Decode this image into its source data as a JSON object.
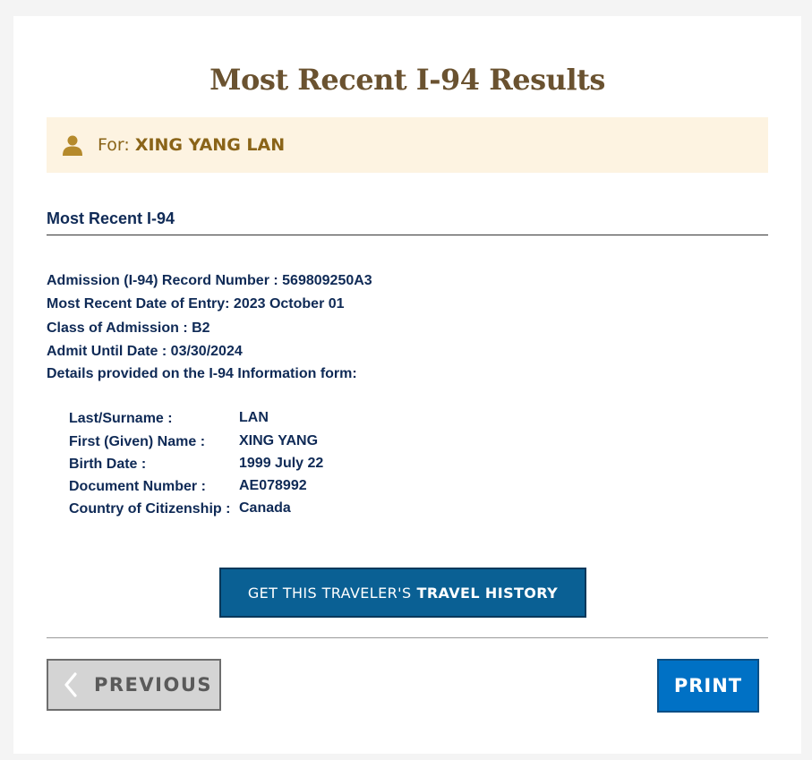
{
  "page": {
    "title": "Most Recent I-94 Results"
  },
  "for_banner": {
    "prefix": "For:",
    "name": "XING YANG LAN",
    "icon": "person-icon"
  },
  "section": {
    "title": "Most Recent I-94"
  },
  "record": {
    "admission_number": "Admission (I-94) Record Number : 569809250A3",
    "entry_date": "Most Recent Date of Entry: 2023 October 01",
    "class_of_admission": "Class of Admission : B2",
    "admit_until": "Admit Until Date : 03/30/2024",
    "details_heading": "Details provided on the I-94 Information form:"
  },
  "details": [
    {
      "label": "Last/Surname :",
      "value": "LAN"
    },
    {
      "label": "First (Given) Name :",
      "value": "XING YANG"
    },
    {
      "label": "Birth Date :",
      "value": "1999 July 22"
    },
    {
      "label": "Document Number :",
      "value": "AE078992"
    },
    {
      "label": "Country of Citizenship :",
      "value": "Canada"
    }
  ],
  "buttons": {
    "travel_history_prefix": "GET THIS TRAVELER'S",
    "travel_history_bold": "TRAVEL HISTORY",
    "previous": "PREVIOUS",
    "print": "PRINT"
  },
  "colors": {
    "title": "#6a5230",
    "banner_bg": "#fdf3e1",
    "banner_text": "#8a6418",
    "text_navy": "#0f2a56",
    "travel_button": "#0a6094",
    "print_button": "#0071c5",
    "previous_button": "#d4d4d4"
  }
}
